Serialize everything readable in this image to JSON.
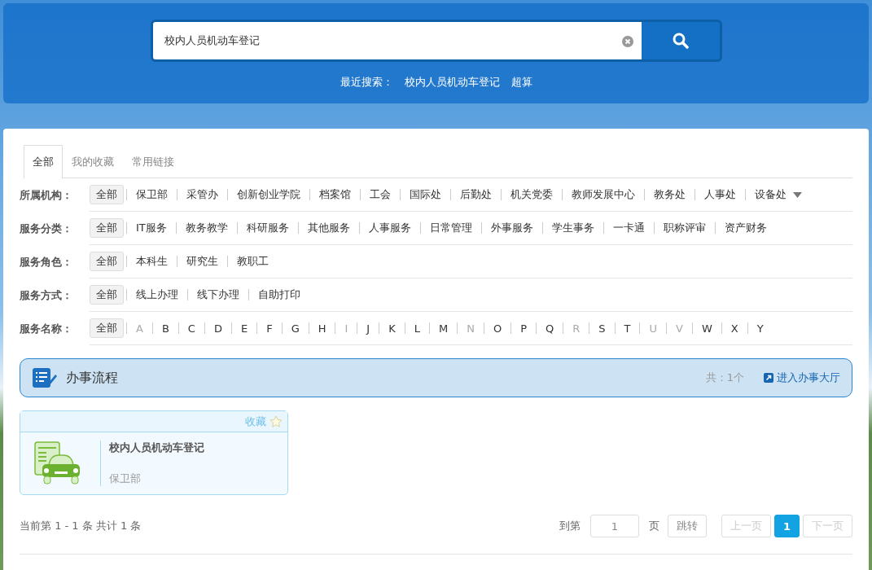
{
  "search": {
    "value": "校内人员机动车登记",
    "recent_label": "最近搜索：",
    "recent": [
      "校内人员机动车登记",
      "超算"
    ]
  },
  "tabs": [
    {
      "label": "全部",
      "selected": true
    },
    {
      "label": "我的收藏",
      "selected": false
    },
    {
      "label": "常用链接",
      "selected": false
    }
  ],
  "filters": [
    {
      "label": "所属机构：",
      "more": true,
      "items": [
        {
          "text": "全部",
          "selected": true,
          "disabled": false
        },
        {
          "text": "保卫部",
          "selected": false,
          "disabled": false
        },
        {
          "text": "采管办",
          "selected": false,
          "disabled": false
        },
        {
          "text": "创新创业学院",
          "selected": false,
          "disabled": false
        },
        {
          "text": "档案馆",
          "selected": false,
          "disabled": false
        },
        {
          "text": "工会",
          "selected": false,
          "disabled": false
        },
        {
          "text": "国际处",
          "selected": false,
          "disabled": false
        },
        {
          "text": "后勤处",
          "selected": false,
          "disabled": false
        },
        {
          "text": "机关党委",
          "selected": false,
          "disabled": false
        },
        {
          "text": "教师发展中心",
          "selected": false,
          "disabled": false
        },
        {
          "text": "教务处",
          "selected": false,
          "disabled": false
        },
        {
          "text": "人事处",
          "selected": false,
          "disabled": false
        },
        {
          "text": "设备处",
          "selected": false,
          "disabled": false
        }
      ]
    },
    {
      "label": "服务分类：",
      "more": false,
      "items": [
        {
          "text": "全部",
          "selected": true,
          "disabled": false
        },
        {
          "text": "IT服务",
          "selected": false,
          "disabled": false
        },
        {
          "text": "教务教学",
          "selected": false,
          "disabled": false
        },
        {
          "text": "科研服务",
          "selected": false,
          "disabled": false
        },
        {
          "text": "其他服务",
          "selected": false,
          "disabled": false
        },
        {
          "text": "人事服务",
          "selected": false,
          "disabled": false
        },
        {
          "text": "日常管理",
          "selected": false,
          "disabled": false
        },
        {
          "text": "外事服务",
          "selected": false,
          "disabled": false
        },
        {
          "text": "学生事务",
          "selected": false,
          "disabled": false
        },
        {
          "text": "一卡通",
          "selected": false,
          "disabled": false
        },
        {
          "text": "职称评审",
          "selected": false,
          "disabled": false
        },
        {
          "text": "资产财务",
          "selected": false,
          "disabled": false
        }
      ]
    },
    {
      "label": "服务角色：",
      "more": false,
      "items": [
        {
          "text": "全部",
          "selected": true,
          "disabled": false
        },
        {
          "text": "本科生",
          "selected": false,
          "disabled": false
        },
        {
          "text": "研究生",
          "selected": false,
          "disabled": false
        },
        {
          "text": "教职工",
          "selected": false,
          "disabled": false
        }
      ]
    },
    {
      "label": "服务方式：",
      "more": false,
      "items": [
        {
          "text": "全部",
          "selected": true,
          "disabled": false
        },
        {
          "text": "线上办理",
          "selected": false,
          "disabled": false
        },
        {
          "text": "线下办理",
          "selected": false,
          "disabled": false
        },
        {
          "text": "自助打印",
          "selected": false,
          "disabled": false
        }
      ]
    },
    {
      "label": "服务名称：",
      "more": false,
      "items": [
        {
          "text": "全部",
          "selected": true,
          "disabled": false
        },
        {
          "text": "A",
          "selected": false,
          "disabled": true
        },
        {
          "text": "B",
          "selected": false,
          "disabled": false
        },
        {
          "text": "C",
          "selected": false,
          "disabled": false
        },
        {
          "text": "D",
          "selected": false,
          "disabled": false
        },
        {
          "text": "E",
          "selected": false,
          "disabled": false
        },
        {
          "text": "F",
          "selected": false,
          "disabled": false
        },
        {
          "text": "G",
          "selected": false,
          "disabled": false
        },
        {
          "text": "H",
          "selected": false,
          "disabled": false
        },
        {
          "text": "I",
          "selected": false,
          "disabled": true
        },
        {
          "text": "J",
          "selected": false,
          "disabled": false
        },
        {
          "text": "K",
          "selected": false,
          "disabled": false
        },
        {
          "text": "L",
          "selected": false,
          "disabled": false
        },
        {
          "text": "M",
          "selected": false,
          "disabled": false
        },
        {
          "text": "N",
          "selected": false,
          "disabled": true
        },
        {
          "text": "O",
          "selected": false,
          "disabled": false
        },
        {
          "text": "P",
          "selected": false,
          "disabled": false
        },
        {
          "text": "Q",
          "selected": false,
          "disabled": false
        },
        {
          "text": "R",
          "selected": false,
          "disabled": true
        },
        {
          "text": "S",
          "selected": false,
          "disabled": false
        },
        {
          "text": "T",
          "selected": false,
          "disabled": false
        },
        {
          "text": "U",
          "selected": false,
          "disabled": true
        },
        {
          "text": "V",
          "selected": false,
          "disabled": true
        },
        {
          "text": "W",
          "selected": false,
          "disabled": false
        },
        {
          "text": "X",
          "selected": false,
          "disabled": false
        },
        {
          "text": "Y",
          "selected": false,
          "disabled": false
        }
      ]
    }
  ],
  "section": {
    "title": "办事流程",
    "count": "共：1个",
    "link": "进入办事大厅"
  },
  "services": [
    {
      "favorite_label": "收藏",
      "favorited": false,
      "name": "校内人员机动车登记",
      "department": "保卫部"
    }
  ],
  "pagination": {
    "summary": "当前第 1 - 1 条 共计 1 条",
    "goto_label": "到第",
    "page_value": "1",
    "page_unit": "页",
    "jump": "跳转",
    "prev": "上一页",
    "next": "下一页",
    "pages": [
      {
        "label": "1",
        "selected": true
      }
    ]
  }
}
